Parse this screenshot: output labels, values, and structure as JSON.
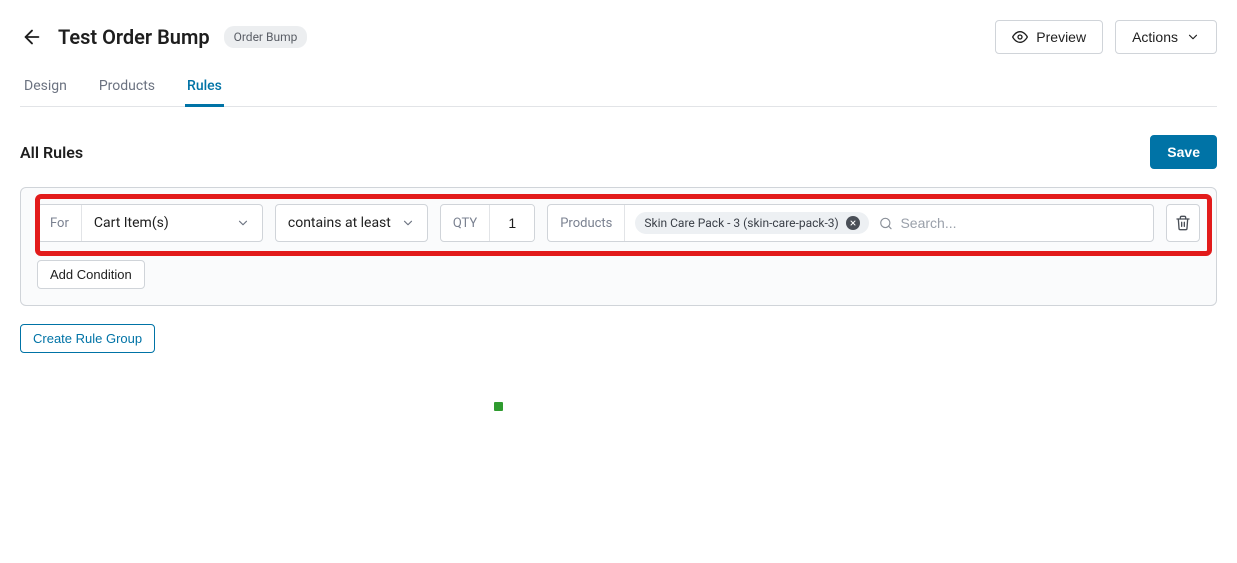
{
  "header": {
    "title": "Test Order Bump",
    "badge": "Order Bump",
    "preview_label": "Preview",
    "actions_label": "Actions"
  },
  "tabs": {
    "design": "Design",
    "products": "Products",
    "rules": "Rules"
  },
  "section": {
    "title": "All Rules",
    "save_label": "Save"
  },
  "rule": {
    "for_label": "For",
    "for_value": "Cart Item(s)",
    "condition_value": "contains at least",
    "qty_label": "QTY",
    "qty_value": "1",
    "products_label": "Products",
    "token_text": "Skin Care Pack - 3 (skin-care-pack-3)",
    "search_placeholder": "Search..."
  },
  "buttons": {
    "add_condition": "Add Condition",
    "create_rule_group": "Create Rule Group"
  }
}
